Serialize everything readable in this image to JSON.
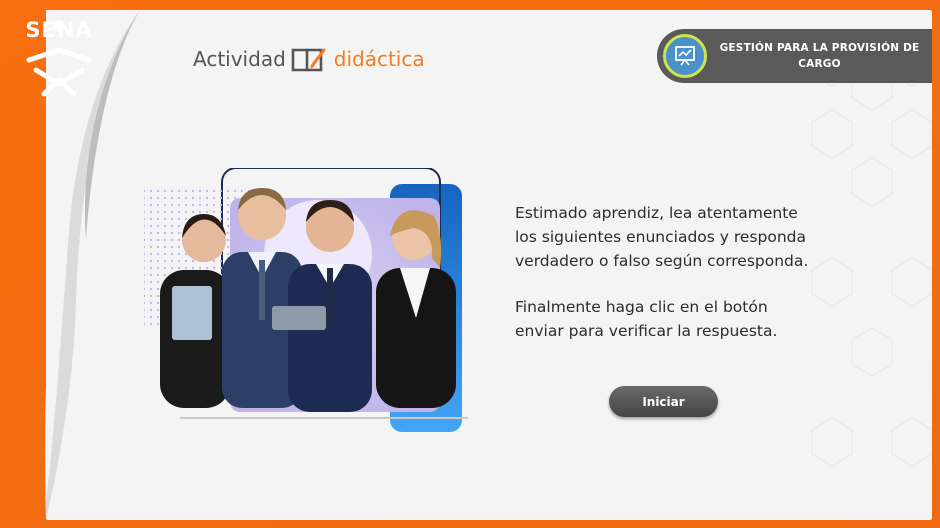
{
  "brand": {
    "logo_text": "SENA",
    "accent_orange": "#f47b20",
    "sena_green": "#39a900"
  },
  "header": {
    "title_part1": "Actividad",
    "title_part2": "didáctica",
    "badge_text": "GESTIÓN PARA LA PROVISIÓN DE CARGO",
    "badge_icon": "presentation-icon"
  },
  "main": {
    "paragraph1": "Estimado aprendiz, lea atentamente los siguientes enunciados y responda verdadero o falso según corresponda.",
    "paragraph2": "Finalmente haga clic en el botón enviar para verificar la respuesta.",
    "start_label": "Iniciar"
  },
  "colors": {
    "badge_bg": "#5a5a5a",
    "button_bg": "#555555",
    "text": "#2c2c2c",
    "card_bg": "#f4f4f4",
    "photo_blue": "#1e88e5"
  }
}
